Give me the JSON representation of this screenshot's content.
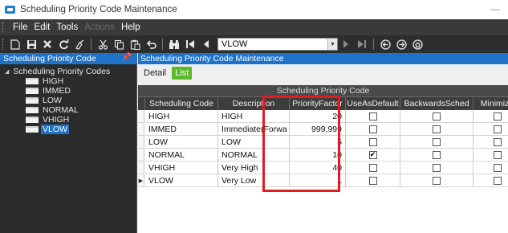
{
  "window": {
    "title": "Scheduling Priority Code Maintenance",
    "minimize_glyph": "—"
  },
  "menu": [
    {
      "label": "File",
      "enabled": true
    },
    {
      "label": "Edit",
      "enabled": true
    },
    {
      "label": "Tools",
      "enabled": true
    },
    {
      "label": "Actions",
      "enabled": false
    },
    {
      "label": "Help",
      "enabled": true
    }
  ],
  "toolbar": {
    "icons": [
      "new-icon",
      "save-icon",
      "delete-icon",
      "refresh-icon",
      "clear-icon",
      "cut-icon",
      "copy-icon",
      "paste-icon",
      "undo-icon",
      "binoculars-icon",
      "first-record-icon",
      "previous-record-icon",
      "next-record-icon",
      "last-record-icon",
      "back-icon",
      "forward-icon",
      "home-icon"
    ],
    "record_selector_value": "VLOW"
  },
  "tree_pane": {
    "header": "Scheduling Priority Code",
    "root_label": "Scheduling Priority Codes",
    "items": [
      {
        "label": "HIGH",
        "selected": false
      },
      {
        "label": "IMMED",
        "selected": false
      },
      {
        "label": "LOW",
        "selected": false
      },
      {
        "label": "NORMAL",
        "selected": false
      },
      {
        "label": "VHIGH",
        "selected": false
      },
      {
        "label": "VLOW",
        "selected": true
      }
    ]
  },
  "main_pane": {
    "header": "Scheduling Priority Code Maintenance",
    "tabs": [
      {
        "label": "Detail",
        "active": false
      },
      {
        "label": "List",
        "active": true
      }
    ]
  },
  "grid": {
    "band_title": "Scheduling Priority Code",
    "columns": [
      "Scheduling Code",
      "Description",
      "PriorityFactor",
      "UseAsDefault",
      "BackwardsSched",
      "Minimize"
    ],
    "rows": [
      {
        "code": "HIGH",
        "description": "HIGH",
        "factor": "20",
        "use_as_default": false,
        "backwards_sched": false,
        "minimize": false,
        "current": false
      },
      {
        "code": "IMMED",
        "description": "Immediate(Forwa",
        "factor": "999,999",
        "use_as_default": false,
        "backwards_sched": false,
        "minimize": false,
        "current": false
      },
      {
        "code": "LOW",
        "description": "LOW",
        "factor": "5",
        "use_as_default": false,
        "backwards_sched": false,
        "minimize": false,
        "current": false
      },
      {
        "code": "NORMAL",
        "description": "NORMAL",
        "factor": "10",
        "use_as_default": true,
        "backwards_sched": false,
        "minimize": false,
        "current": false
      },
      {
        "code": "VHIGH",
        "description": "Very High",
        "factor": "40",
        "use_as_default": false,
        "backwards_sched": false,
        "minimize": false,
        "current": false
      },
      {
        "code": "VLOW",
        "description": "Very Low",
        "factor": "1",
        "use_as_default": false,
        "backwards_sched": false,
        "minimize": false,
        "current": true
      }
    ],
    "highlight_color": "#e01b23"
  }
}
